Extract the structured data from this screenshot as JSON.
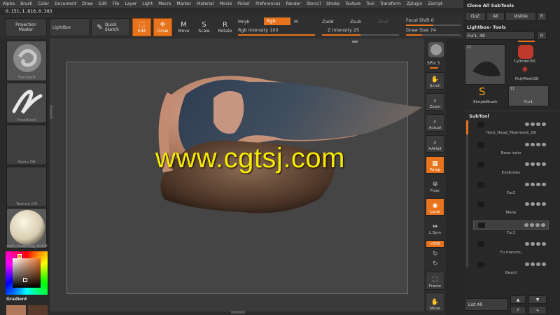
{
  "menu": [
    "Alpha",
    "Brush",
    "Color",
    "Document",
    "Draw",
    "Edit",
    "File",
    "Layer",
    "Light",
    "Macro",
    "Marker",
    "Material",
    "Movie",
    "Picker",
    "Preferences",
    "Render",
    "Stencil",
    "Stroke",
    "Texture",
    "Tool",
    "Transform",
    "Zplugin",
    "Zscript"
  ],
  "coords": "0.151,1.816,0.383",
  "shelf": {
    "projection_master": "Projection Master",
    "lightbox": "LightBox",
    "quick_sketch": "Quick Sketch",
    "edit": "Edit",
    "draw": "Draw",
    "move": "Move",
    "scale": "Scale",
    "rotate": "Rotate",
    "mrgb": "Mrgb",
    "rgb": "Rgb",
    "m": "M",
    "zadd": "Zadd",
    "zsub": "Zsub",
    "zcut": "Zcut",
    "rgb_intensity": "Rgb Intensity 100",
    "z_intensity": "Z Intensity 25",
    "focal_shift": "Focal Shift 0",
    "draw_size": "Draw Size 74"
  },
  "left": {
    "standard": "Standard",
    "freehand": "FreeHand",
    "alpha_off": "Alpha Off",
    "texture_off": "Texture Off",
    "material": "mah_modeling_matH",
    "gradient": "Gradient"
  },
  "canvas": {
    "watermark": "www.cgtsj.com"
  },
  "righttools": {
    "spix": "SPix 3",
    "scroll": "Scroll",
    "zoom": "Zoom",
    "actual": "Actual",
    "aahalf": "AAHalf",
    "persp": "Persp",
    "floor": "Floor",
    "local": "Local",
    "lsym": "L.Sym",
    "xyz": "•XYZ",
    "frame": "Frame",
    "move": "Move"
  },
  "tray": {
    "clone_all": "Clone All SubTools",
    "goz": "GoZ",
    "all": "All",
    "visible": "Visible",
    "r": "R",
    "lightbox_tools": "Lightbox› Tools",
    "fur_value": "Fur1. 48",
    "r2": "R",
    "tool_count": "11",
    "cylinder": "Cylinder3D",
    "polymesh": "PolyMesh3D",
    "simplebrush": "SimpleBrush",
    "fur1_thumb": "Fur1",
    "subtool_title": "SubTool",
    "list_all": "List All"
  },
  "subtools": [
    "Horb_Head_Fibermesh_08",
    "Nose hairs",
    "Eyebrows",
    "Fur2",
    "Mane",
    "Fur1",
    "Fu manchu",
    "Beard"
  ],
  "colors": {
    "accent": "#e7731c",
    "watermark": "#f7ea00"
  }
}
